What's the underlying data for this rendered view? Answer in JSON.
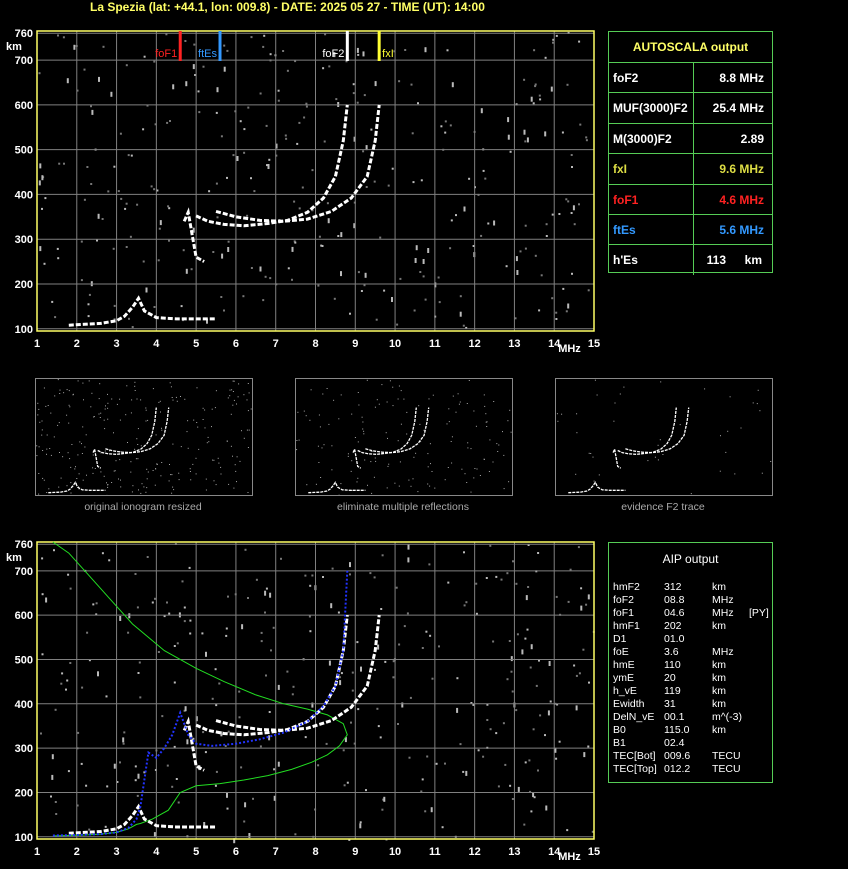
{
  "header": {
    "title": "La Spezia (lat: +44.1, lon: 009.8) - DATE: 2025 05 27 - TIME (UT): 14:00"
  },
  "colors": {
    "grid": "#808080",
    "axis": "#ffff66",
    "panel_border": "#55cc55",
    "foF1": "#ff2222",
    "ftEs": "#3399ff",
    "foF2": "#ffffff",
    "fxI": "#ffff33",
    "profile": "#22dd22",
    "fit": "#2233ff"
  },
  "autoscala": {
    "title": "AUTOSCALA output",
    "rows": [
      {
        "label": "foF2",
        "value": "8.8 MHz",
        "color": "#ffffff"
      },
      {
        "label": "MUF(3000)F2",
        "value": "25.4 MHz",
        "color": "#ffffff"
      },
      {
        "label": "M(3000)F2",
        "value": "2.89",
        "color": "#ffffff"
      },
      {
        "label": "fxI",
        "value": "9.6 MHz",
        "color": "#dddd44"
      },
      {
        "label": "foF1",
        "value": "4.6 MHz",
        "color": "#ff2222"
      },
      {
        "label": "ftEs",
        "value": "5.6 MHz",
        "color": "#3399ff"
      },
      {
        "label": "h'Es",
        "value": "113",
        "unit": "km",
        "color": "#ffffff"
      }
    ]
  },
  "aip": {
    "title": "AIP output",
    "rows": [
      {
        "label": "hmF2",
        "value": "312",
        "unit": "km",
        "extra": ""
      },
      {
        "label": "foF2",
        "value": "08.8",
        "unit": "MHz",
        "extra": ""
      },
      {
        "label": "foF1",
        "value": "04.6",
        "unit": "MHz",
        "extra": "[PY]"
      },
      {
        "label": "hmF1",
        "value": "202",
        "unit": "km",
        "extra": ""
      },
      {
        "label": "D1",
        "value": "01.0",
        "unit": "",
        "extra": ""
      },
      {
        "label": "foE",
        "value": "3.6",
        "unit": "MHz",
        "extra": ""
      },
      {
        "label": "hmE",
        "value": "110",
        "unit": "km",
        "extra": ""
      },
      {
        "label": "ymE",
        "value": "20",
        "unit": "km",
        "extra": ""
      },
      {
        "label": "h_vE",
        "value": "119",
        "unit": "km",
        "extra": ""
      },
      {
        "label": "Ewidth",
        "value": "31",
        "unit": "km",
        "extra": ""
      },
      {
        "label": "DelN_vE",
        "value": "00.1",
        "unit": "m^(-3)",
        "extra": ""
      },
      {
        "label": "B0",
        "value": "115.0",
        "unit": "km",
        "extra": ""
      },
      {
        "label": "B1",
        "value": "02.4",
        "unit": "",
        "extra": ""
      },
      {
        "label": "TEC[Bot]",
        "value": "009.6",
        "unit": "TECU",
        "extra": ""
      },
      {
        "label": "TEC[Top]",
        "value": "012.2",
        "unit": "TECU",
        "extra": ""
      }
    ]
  },
  "thumbnails": [
    {
      "caption": "original ionogram resized"
    },
    {
      "caption": "eliminate multiple reflections"
    },
    {
      "caption": "evidence F2 trace"
    }
  ],
  "chart_data": [
    {
      "type": "scatter",
      "title": "",
      "xlabel": "MHz",
      "ylabel": "km",
      "xlim": [
        1,
        15
      ],
      "ylim": [
        95,
        765
      ],
      "x_ticks": [
        1,
        2,
        3,
        4,
        5,
        6,
        7,
        8,
        9,
        10,
        11,
        12,
        13,
        14,
        15
      ],
      "y_ticks": [
        100,
        200,
        300,
        400,
        500,
        600,
        700,
        760
      ],
      "grid": true,
      "markers": [
        {
          "name": "foF1",
          "x": 4.6,
          "color": "#ff2222"
        },
        {
          "name": "ftEs",
          "x": 5.6,
          "color": "#3399ff"
        },
        {
          "name": "foF2",
          "x": 8.8,
          "color": "#ffffff"
        },
        {
          "name": "fxI",
          "x": 9.6,
          "color": "#ffff33"
        }
      ],
      "series": [
        {
          "name": "E trace",
          "x": [
            1.8,
            2.2,
            2.6,
            3.0,
            3.2,
            3.4,
            3.55,
            3.7,
            4.0,
            4.5,
            5.0,
            5.5
          ],
          "y": [
            108,
            110,
            112,
            118,
            128,
            148,
            168,
            140,
            125,
            122,
            122,
            122
          ]
        },
        {
          "name": "F trace (ordinary)",
          "x": [
            5.0,
            5.3,
            5.7,
            6.2,
            6.8,
            7.3,
            7.8,
            8.2,
            8.5,
            8.7,
            8.8
          ],
          "y": [
            352,
            340,
            333,
            330,
            335,
            342,
            360,
            392,
            440,
            520,
            600
          ]
        },
        {
          "name": "F trace (extraordinary)",
          "x": [
            5.5,
            6.0,
            6.6,
            7.2,
            7.8,
            8.4,
            8.9,
            9.3,
            9.5,
            9.6
          ],
          "y": [
            362,
            350,
            342,
            340,
            345,
            362,
            392,
            440,
            520,
            600
          ]
        },
        {
          "name": "F1 cusp",
          "x": [
            4.7,
            4.8,
            5.0,
            5.2
          ],
          "y": [
            340,
            360,
            260,
            250
          ]
        }
      ]
    },
    {
      "type": "line",
      "title": "",
      "xlabel": "MHz",
      "ylabel": "km",
      "xlim": [
        1,
        15
      ],
      "ylim": [
        95,
        765
      ],
      "x_ticks": [
        1,
        2,
        3,
        4,
        5,
        6,
        7,
        8,
        9,
        10,
        11,
        12,
        13,
        14,
        15
      ],
      "y_ticks": [
        100,
        200,
        300,
        400,
        500,
        600,
        700,
        760
      ],
      "grid": true,
      "series": [
        {
          "name": "electron density profile",
          "x": [
            1.4,
            1.8,
            2.2,
            2.6,
            3.0,
            3.3,
            3.5,
            3.6,
            3.9,
            4.3,
            4.6,
            5.0,
            5.6,
            6.2,
            6.8,
            7.4,
            7.9,
            8.3,
            8.6,
            8.8,
            8.7,
            8.3,
            7.8,
            7.2,
            6.5,
            5.7,
            5.0,
            4.2,
            3.4,
            2.8,
            2.3,
            1.8,
            1.4
          ],
          "y": [
            102,
            103,
            104,
            106,
            110,
            118,
            128,
            130,
            140,
            160,
            200,
            215,
            220,
            228,
            238,
            252,
            268,
            285,
            305,
            330,
            355,
            375,
            388,
            400,
            420,
            450,
            480,
            520,
            580,
            640,
            690,
            740,
            765
          ]
        },
        {
          "name": "fitted trace",
          "x": [
            1.4,
            2.0,
            2.6,
            3.0,
            3.3,
            3.5,
            3.6,
            3.8,
            4.0,
            4.2,
            4.4,
            4.6,
            4.8,
            5.0,
            5.4,
            6.0,
            6.6,
            7.2,
            7.8,
            8.2,
            8.5,
            8.7,
            8.8
          ],
          "y": [
            103,
            104,
            106,
            110,
            120,
            140,
            168,
            290,
            278,
            300,
            330,
            380,
            330,
            310,
            305,
            310,
            320,
            335,
            360,
            395,
            440,
            520,
            700
          ]
        }
      ]
    }
  ]
}
